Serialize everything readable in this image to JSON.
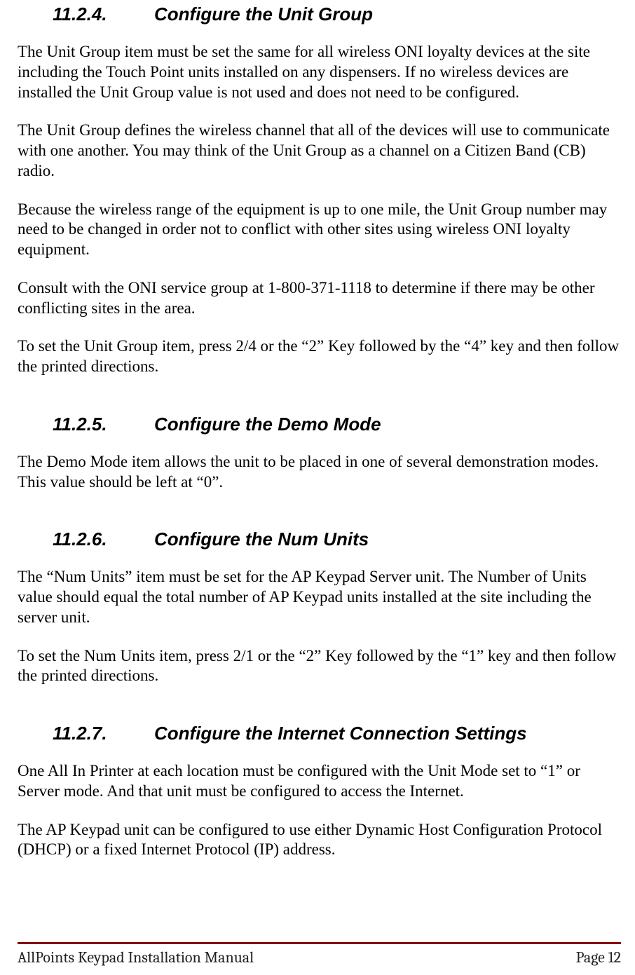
{
  "sections": {
    "s1": {
      "num": "11.2.4.",
      "title": "Configure the Unit Group",
      "paras": [
        "The Unit Group item must be set the same for all wireless ONI loyalty devices at the site including the Touch Point units installed on any dispensers.  If no wireless devices are installed the Unit Group value is not used and does not need to be configured.",
        "The Unit Group defines the wireless channel that all of the devices will use to communicate with one another.  You may think of the Unit Group as a channel on a Citizen Band (CB) radio.",
        "Because the wireless range of the equipment is up to one mile, the Unit Group number may need to be changed in order not to conflict with other sites using wireless ONI loyalty equipment.",
        "Consult with the ONI service group at 1-800-371-1118 to determine if there may be other conflicting sites in the area.",
        "To set the Unit Group item, press 2/4 or the “2” Key followed by the “4” key and then follow the printed directions."
      ]
    },
    "s2": {
      "num": "11.2.5.",
      "title": "Configure the Demo Mode",
      "paras": [
        "The Demo Mode item allows the unit to be placed in one of several demonstration modes.  This value should be left at “0”."
      ]
    },
    "s3": {
      "num": "11.2.6.",
      "title": "Configure the Num Units",
      "paras": [
        "The “Num Units” item must be set for the AP Keypad Server unit.  The Number of Units value should equal the total number of AP Keypad units installed at the site including the server unit.",
        "To set the Num Units item, press 2/1 or the “2” Key followed by the “1” key and then follow the printed directions."
      ]
    },
    "s4": {
      "num": "11.2.7.",
      "title": "Configure the Internet Connection Settings",
      "paras": [
        "One All In Printer at each location must be configured with the Unit Mode set to “1” or Server mode.  And that unit must be configured to access the Internet.",
        "The AP Keypad unit can be configured to use either Dynamic Host Configuration Protocol (DHCP) or a fixed Internet Protocol (IP) address."
      ]
    }
  },
  "footer": {
    "left": "AllPoints Keypad Installation Manual",
    "right": "Page 12"
  }
}
